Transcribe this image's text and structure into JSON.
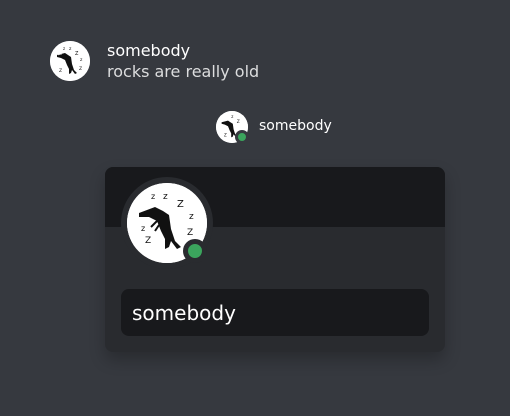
{
  "message": {
    "author": "somebody",
    "text": "rocks are really old",
    "avatar_icon": "sleeping-dinosaur-icon"
  },
  "member": {
    "name": "somebody",
    "status": "online",
    "avatar_icon": "sleeping-dinosaur-icon"
  },
  "profile_popout": {
    "username": "somebody",
    "status": "online",
    "avatar_icon": "sleeping-dinosaur-icon"
  },
  "colors": {
    "background": "#36393f",
    "popout": "#292b2f",
    "banner": "#18191c",
    "status_online": "#3ba55d"
  }
}
